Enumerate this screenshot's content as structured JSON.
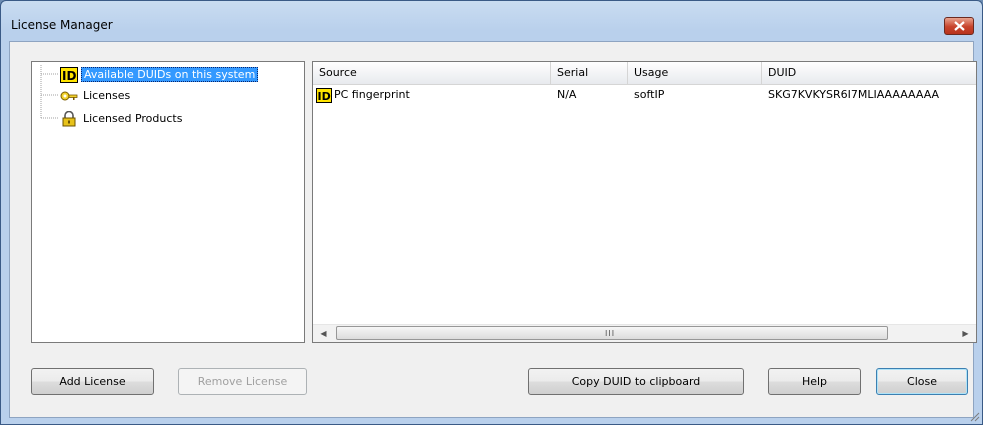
{
  "window": {
    "title": "License Manager"
  },
  "tree": {
    "items": [
      {
        "label": "Available DUIDs on this system",
        "icon": "id-icon",
        "selected": true
      },
      {
        "label": "Licenses",
        "icon": "key-icon",
        "selected": false
      },
      {
        "label": "Licensed Products",
        "icon": "lock-icon",
        "selected": false
      }
    ]
  },
  "list": {
    "columns": [
      "Source",
      "Serial",
      "Usage",
      "DUID"
    ],
    "rows": [
      {
        "source": "PC fingerprint",
        "serial": "N/A",
        "usage": "softIP",
        "duid": "SKG7KVKYSR6I7MLIAAAAAAAA"
      }
    ],
    "scroll_grip": "III"
  },
  "buttons": {
    "add_license": "Add License",
    "remove_license": "Remove License",
    "copy_duid": "Copy DUID to clipboard",
    "help": "Help",
    "close": "Close"
  },
  "colors": {
    "selection": "#3399ff",
    "close_button": "#c7432b",
    "title_bar": "#b9d0ec"
  }
}
